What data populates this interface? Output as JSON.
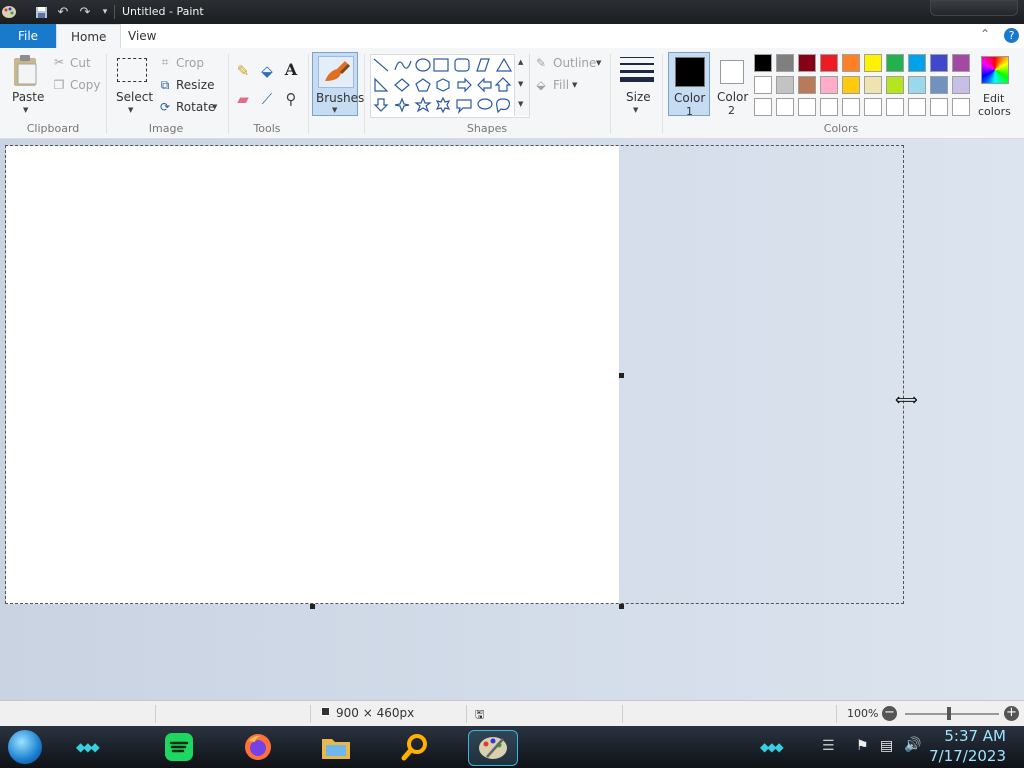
{
  "window": {
    "title": "Untitled - Paint"
  },
  "tabs": [
    {
      "label": "File"
    },
    {
      "label": "Home"
    },
    {
      "label": "View"
    }
  ],
  "help_icon": "?",
  "clipboard": {
    "group_label": "Clipboard",
    "paste": "Paste",
    "cut": "Cut",
    "copy": "Copy"
  },
  "image": {
    "group_label": "Image",
    "select": "Select",
    "crop": "Crop",
    "resize": "Resize",
    "rotate": "Rotate"
  },
  "tools": {
    "group_label": "Tools",
    "text_tool": "A"
  },
  "brushes": {
    "label": "Brushes"
  },
  "shapes": {
    "group_label": "Shapes",
    "outline": "Outline",
    "fill": "Fill"
  },
  "size": {
    "label": "Size"
  },
  "colors": {
    "group_label": "Colors",
    "color1_label": "Color",
    "color1_num": "1",
    "color2_label": "Color",
    "color2_num": "2",
    "edit_label": "Edit",
    "edit_label2": "colors",
    "color1": "#000000",
    "color2": "#ffffff",
    "palette_row1": [
      "#000000",
      "#7f7f7f",
      "#880015",
      "#ed1c24",
      "#ff7f27",
      "#fff200",
      "#22b14c",
      "#00a2e8",
      "#3f48cc",
      "#a349a4"
    ],
    "palette_row2": [
      "#ffffff",
      "#c3c3c3",
      "#b97a57",
      "#ffaec9",
      "#ffc90e",
      "#efe4b0",
      "#b5e61d",
      "#99d9ea",
      "#7092be",
      "#c8bfe7"
    ],
    "palette_row3": [
      "#ffffff",
      "#ffffff",
      "#ffffff",
      "#ffffff",
      "#ffffff",
      "#ffffff",
      "#ffffff",
      "#ffffff",
      "#ffffff",
      "#ffffff"
    ]
  },
  "status": {
    "dimensions": "900 × 460px",
    "zoom": "100%"
  },
  "taskbar": {
    "time": "5:37 AM",
    "date": "7/17/2023"
  }
}
